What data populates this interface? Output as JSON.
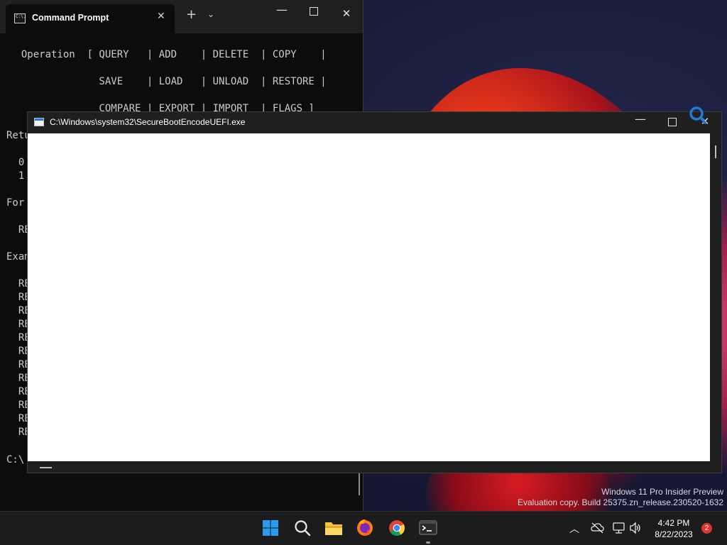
{
  "desktop": {
    "watermark_line1": "Windows 11 Pro Insider Preview",
    "watermark_line2": "Evaluation copy. Build 25375.zn_release.230520-1632"
  },
  "terminal": {
    "tab_icon_text": "C:\\.",
    "tab_title": "Command Prompt",
    "close_glyph": "✕",
    "newtab_glyph": "+",
    "dropdown_glyph": "⌄",
    "minimize_glyph": "—",
    "close_window_glyph": "✕",
    "lines": [
      "  Operation  [ QUERY   | ADD    | DELETE  | COPY    |",
      "               SAVE    | LOAD   | UNLOAD  | RESTORE |",
      "               COMPARE | EXPORT | IMPORT  | FLAGS ]",
      "Retu",
      "  0",
      "  1",
      "For",
      "  RE",
      "Exam",
      "  RE",
      "  RE",
      "  RE",
      "  RE",
      "  RE",
      "  RE",
      "  RE",
      "  RE",
      "  RE",
      "  RE",
      "  RE",
      "  RE",
      "C:\\"
    ]
  },
  "app_window": {
    "title": "C:\\Windows\\system32\\SecureBootEncodeUEFI.exe",
    "minimize_glyph": "—",
    "close_glyph": "✕"
  },
  "taskbar": {
    "apps": [
      "start",
      "search",
      "file-explorer",
      "firefox",
      "chrome",
      "terminal"
    ],
    "active_app": "terminal",
    "clock_time": "4:42 PM",
    "clock_date": "8/22/2023",
    "notification_count": "2",
    "tray_chevron": "︿"
  },
  "colors": {
    "terminal_bg": "#0c0c0c",
    "terminal_text": "#cccccc",
    "window_chrome": "#1f1f1f",
    "taskbar_bg": "#1c1c1c",
    "windows_blue": "#0f6cbd",
    "notif_badge": "#e0352b"
  }
}
